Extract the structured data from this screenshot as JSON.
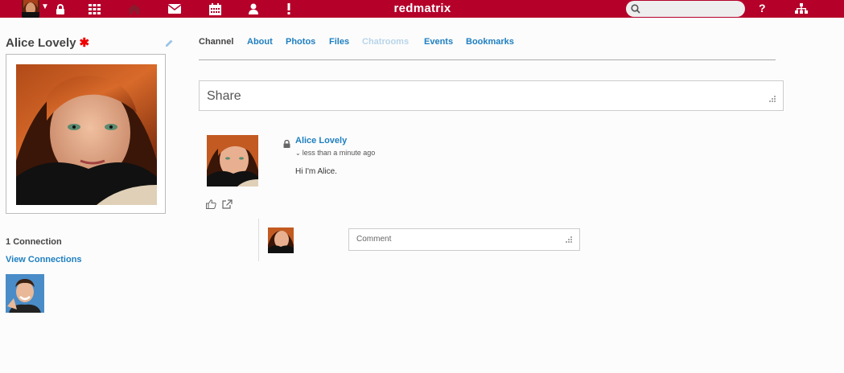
{
  "nav": {
    "brand": "redmatrix",
    "search_placeholder": "",
    "help": "?",
    "accent": "#b5002a",
    "icons": [
      "avatar",
      "lock-icon",
      "apps-grid-icon",
      "home-icon",
      "mail-icon",
      "calendar-icon",
      "user-icon",
      "notice-icon",
      "search-icon",
      "help-icon",
      "sitemap-icon"
    ]
  },
  "profile": {
    "name": "Alice Lovely",
    "star": "✱",
    "connections_count": "1",
    "connections_label": "Connection",
    "view_connections": "View Connections"
  },
  "tabs": [
    {
      "label": "Channel",
      "state": "active"
    },
    {
      "label": "About",
      "state": "normal"
    },
    {
      "label": "Photos",
      "state": "normal"
    },
    {
      "label": "Files",
      "state": "normal"
    },
    {
      "label": "Chatrooms",
      "state": "disabled"
    },
    {
      "label": "Events",
      "state": "normal"
    },
    {
      "label": "Bookmarks",
      "state": "normal"
    }
  ],
  "share": {
    "placeholder": "Share"
  },
  "post": {
    "author": "Alice Lovely",
    "time": "less than a minute ago",
    "body": "Hi I'm Alice."
  },
  "comment": {
    "placeholder": "Comment"
  }
}
